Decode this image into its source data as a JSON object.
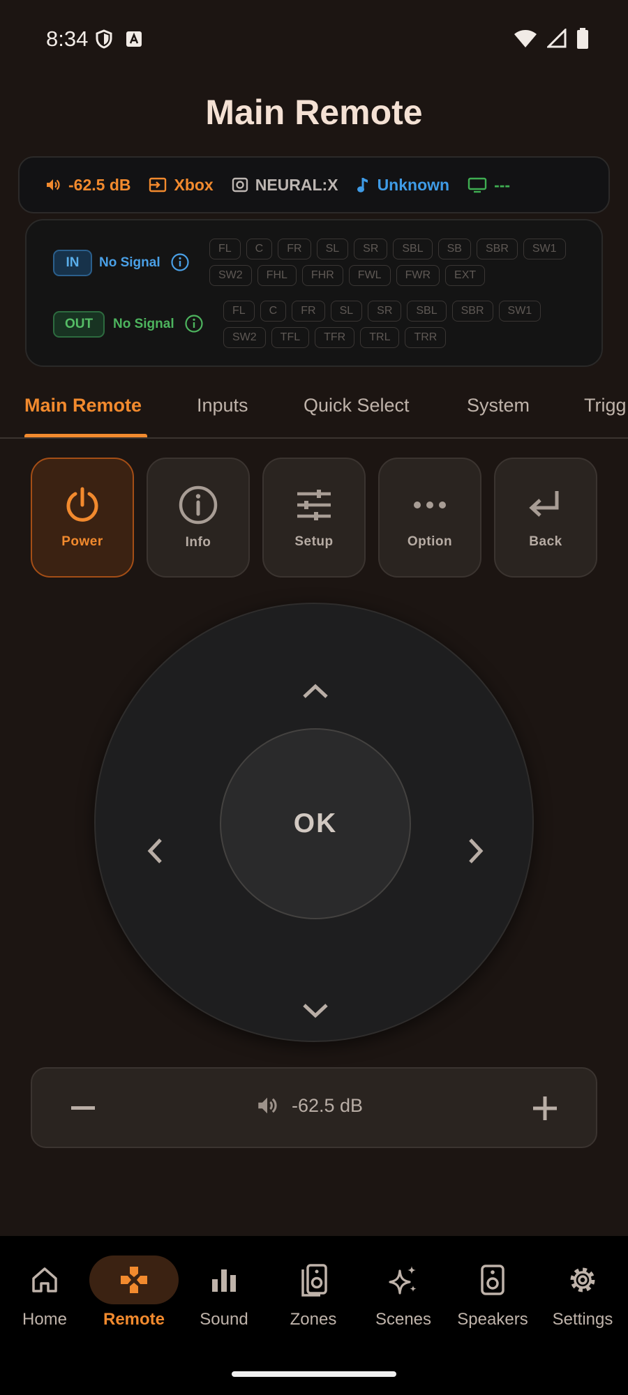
{
  "status_bar": {
    "time": "8:34"
  },
  "title": "Main Remote",
  "summary": {
    "volume": "-62.5 dB",
    "input": "Xbox",
    "mode": "NEURAL:X",
    "audio": "Unknown",
    "video": "---"
  },
  "signal": {
    "in_label": "IN",
    "in_status": "No Signal",
    "in_channels": [
      "FL",
      "C",
      "FR",
      "SL",
      "SR",
      "SBL",
      "SB",
      "SBR",
      "SW1",
      "SW2",
      "FHL",
      "FHR",
      "FWL",
      "FWR",
      "EXT"
    ],
    "out_label": "OUT",
    "out_status": "No Signal",
    "out_channels": [
      "FL",
      "C",
      "FR",
      "SL",
      "SR",
      "SBL",
      "SBR",
      "SW1",
      "SW2",
      "TFL",
      "TFR",
      "TRL",
      "TRR"
    ]
  },
  "tabs": [
    "Main Remote",
    "Inputs",
    "Quick Select",
    "System",
    "Trigg"
  ],
  "quick_buttons": {
    "power": "Power",
    "info": "Info",
    "setup": "Setup",
    "option": "Option",
    "back": "Back"
  },
  "dpad": {
    "ok": "OK"
  },
  "volume_bar": {
    "value": "-62.5 dB"
  },
  "nav": {
    "home": "Home",
    "remote": "Remote",
    "sound": "Sound",
    "zones": "Zones",
    "scenes": "Scenes",
    "speakers": "Speakers",
    "settings": "Settings"
  },
  "colors": {
    "accent": "#f28a2e",
    "background": "#1c1512",
    "in_blue": "#4aa0e6",
    "out_green": "#4db45e"
  }
}
